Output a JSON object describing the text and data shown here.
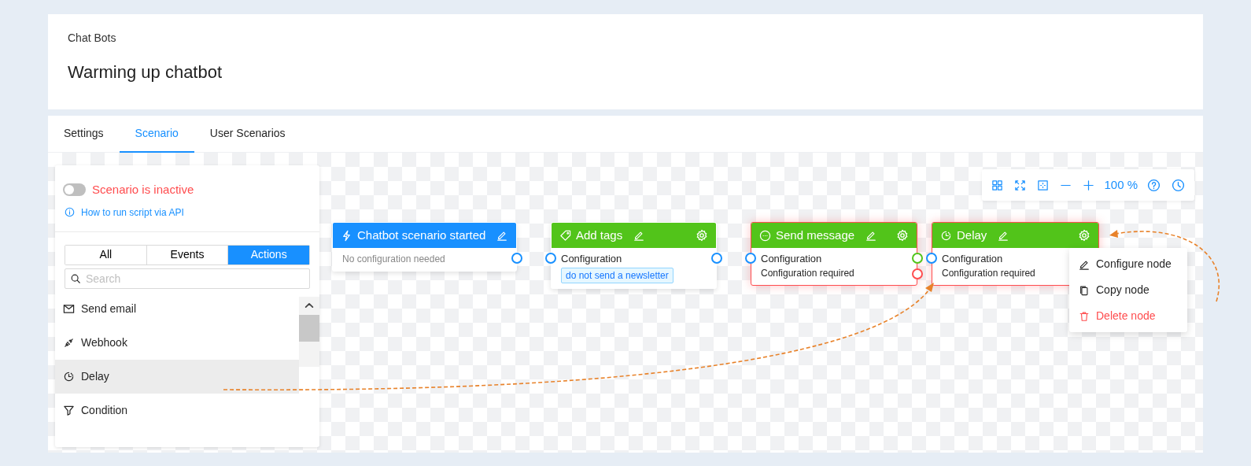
{
  "breadcrumb": "Chat Bots",
  "title": "Warming up chatbot",
  "tabs": [
    {
      "label": "Settings",
      "selected": false
    },
    {
      "label": "Scenario",
      "selected": true
    },
    {
      "label": "User Scenarios",
      "selected": false
    }
  ],
  "sidebar": {
    "status": {
      "on": false,
      "label": "Scenario is inactive"
    },
    "help_link": "How to run script via API",
    "filters": [
      {
        "label": "All",
        "selected": false
      },
      {
        "label": "Events",
        "selected": false
      },
      {
        "label": "Actions",
        "selected": true
      }
    ],
    "search": {
      "placeholder": "Search"
    },
    "items": [
      {
        "kind": "mail",
        "label": "Send email",
        "selected": false
      },
      {
        "kind": "webhook",
        "label": "Webhook",
        "selected": false
      },
      {
        "kind": "clock",
        "label": "Delay",
        "selected": true
      },
      {
        "kind": "filter",
        "label": "Condition",
        "selected": false
      }
    ]
  },
  "toolbar": {
    "left": [
      {
        "kind": "grid"
      },
      {
        "kind": "expand"
      },
      {
        "kind": "fit"
      },
      {
        "kind": "minus"
      },
      {
        "kind": "plus"
      }
    ],
    "zoom": "100 %",
    "right": [
      {
        "kind": "help"
      },
      {
        "kind": "history"
      }
    ]
  },
  "nodes": [
    {
      "kind": "trigger",
      "title": "Chatbot scenario started",
      "error": false,
      "input": false,
      "note": "No configuration needed",
      "outputs": [
        {
          "color": "#1890ff"
        }
      ]
    },
    {
      "kind": "action",
      "title": "Add tags",
      "error": false,
      "input": true,
      "lines": [
        "Configuration"
      ],
      "tags": [
        "do not send a newsletter"
      ],
      "outputs": [
        {
          "color": "#1890ff"
        }
      ]
    },
    {
      "kind": "action",
      "title": "Send message",
      "error": true,
      "input": true,
      "lines": [
        "Configuration",
        "Configuration required"
      ],
      "outputs": [
        {
          "color": "#52c41a"
        },
        {
          "color": "#ff4d4f"
        }
      ]
    },
    {
      "kind": "action",
      "title": "Delay",
      "error": true,
      "input": true,
      "lines": [
        "Configuration",
        "Configuration required"
      ]
    }
  ],
  "context_menu": {
    "items": [
      {
        "kind": "edit",
        "label": "Configure node"
      },
      {
        "kind": "copy",
        "label": "Copy node"
      },
      {
        "kind": "delete",
        "label": "Delete node"
      }
    ]
  }
}
